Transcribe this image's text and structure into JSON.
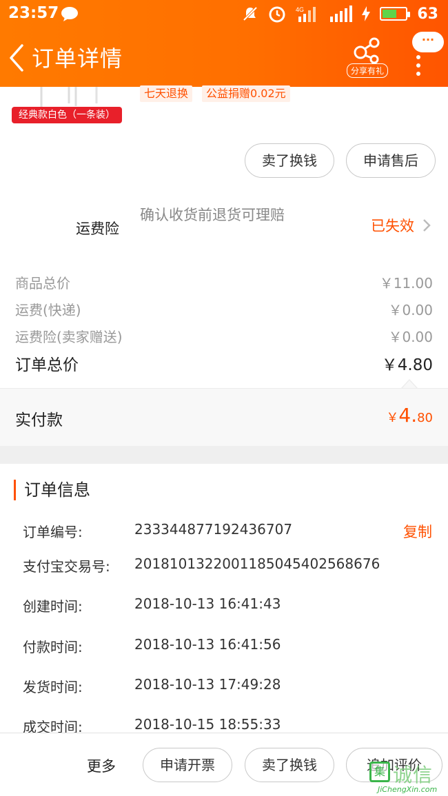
{
  "status_bar": {
    "time": "23:57",
    "battery": "63",
    "battery_level": 0.63
  },
  "header": {
    "title": "订单详情",
    "share_label": "分享有礼",
    "more_bubble": "···"
  },
  "product": {
    "tag": "经典款白色（一条装）",
    "service_tags": [
      "七天退换",
      "公益捐赠0.02元"
    ]
  },
  "actions": {
    "sell_label": "卖了换钱",
    "after_sale_label": "申请售后"
  },
  "insurance": {
    "name": "运费险",
    "description": "确认收货前退货可理赔",
    "status": "已失效"
  },
  "prices": [
    {
      "label": "商品总价",
      "value": "￥11.00"
    },
    {
      "label": "运费(快递)",
      "value": "￥0.00"
    },
    {
      "label": "运费险(卖家赠送)",
      "value": "￥0.00"
    }
  ],
  "order_total": {
    "label": "订单总价",
    "value": "￥4.80"
  },
  "paid": {
    "label": "实付款",
    "currency": "￥",
    "integer": "4.",
    "decimal": "80"
  },
  "order_info": {
    "title": "订单信息",
    "copy_label": "复制",
    "rows": [
      {
        "key": "订单编号:",
        "value": "233344877192436707"
      },
      {
        "key": "支付宝交易号:",
        "value": "2018101322001185045402568676"
      },
      {
        "key": "创建时间:",
        "value": "2018-10-13 16:41:43"
      },
      {
        "key": "付款时间:",
        "value": "2018-10-13 16:41:56"
      },
      {
        "key": "发货时间:",
        "value": "2018-10-13 17:49:28"
      },
      {
        "key": "成交时间:",
        "value": "2018-10-15 18:55:33"
      }
    ]
  },
  "bottom_bar": {
    "more_label": "更多",
    "buttons": [
      "申请开票",
      "卖了换钱",
      "追加评价"
    ]
  },
  "watermark": {
    "cn": "诚信",
    "en": "JiChengXin.com"
  },
  "colors": {
    "accent": "#ff5000",
    "header": "#ff6f00"
  }
}
